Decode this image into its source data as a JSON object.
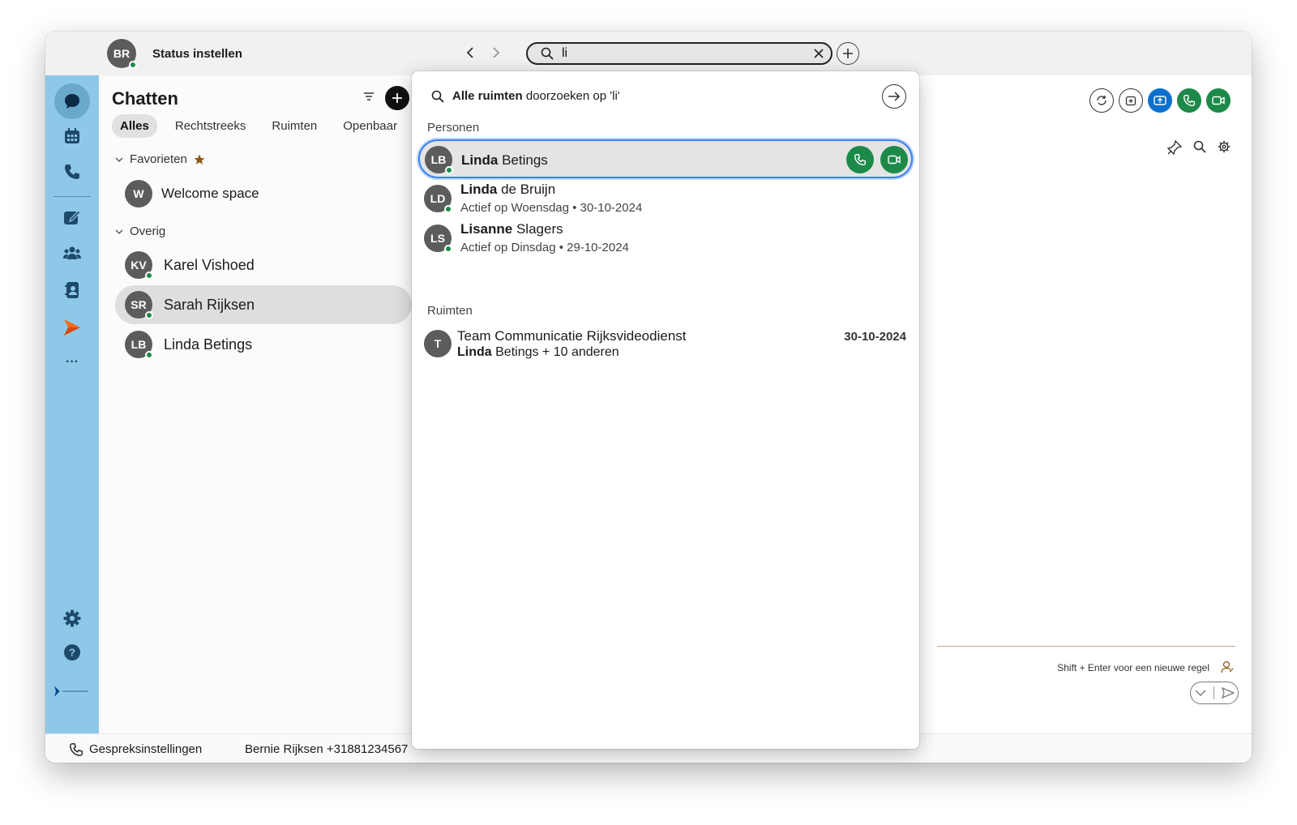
{
  "titlebar": {
    "user_initials": "BR",
    "status_label": "Status instellen",
    "search_value": "li",
    "icons": [
      "back-icon",
      "forward-icon",
      "search-icon",
      "clear-icon",
      "plus-icon"
    ]
  },
  "rail": {
    "items": [
      "chat-icon",
      "calendar-icon",
      "phone-icon",
      "compose-icon",
      "teams-icon",
      "contacts-icon",
      "send-app-icon",
      "more-icon",
      "settings-icon",
      "help-icon",
      "brand-logo"
    ],
    "more_label": "···"
  },
  "chats": {
    "title": "Chatten",
    "tabs": [
      {
        "label": "Alles",
        "active": true
      },
      {
        "label": "Rechtstreeks",
        "active": false
      },
      {
        "label": "Ruimten",
        "active": false
      },
      {
        "label": "Openbaar",
        "active": false
      }
    ],
    "favorites_label": "Favorieten",
    "favorites": [
      {
        "initials": "W",
        "name": "Welcome space"
      }
    ],
    "other_label": "Overig",
    "other": [
      {
        "initials": "KV",
        "name": "Karel Vishoed",
        "selected": false
      },
      {
        "initials": "SR",
        "name": "Sarah Rijksen",
        "selected": true
      },
      {
        "initials": "LB",
        "name": "Linda Betings",
        "selected": false
      }
    ]
  },
  "bottombar": {
    "call_settings": "Gespreksinstellingen",
    "caller": "Bernie Rijksen +31881234567"
  },
  "right_pane": {
    "composer_hint": "Shift + Enter voor een nieuwe regel"
  },
  "dropdown": {
    "search_all_bold": "Alle ruimten",
    "search_all_rest": " doorzoeken op 'li'",
    "people_label": "Personen",
    "people": [
      {
        "initials": "LB",
        "name_bold": "Linda",
        "name_rest": " Betings",
        "sub": "",
        "highlighted": true
      },
      {
        "initials": "LD",
        "name_bold": "Linda",
        "name_rest": " de Bruijn",
        "sub": "Actief op Woensdag • 30-10-2024",
        "highlighted": false
      },
      {
        "initials": "LS",
        "name_bold": "Lisanne",
        "name_rest": " Slagers",
        "sub": "Actief op Dinsdag • 29-10-2024",
        "highlighted": false
      }
    ],
    "rooms_label": "Ruimten",
    "rooms": [
      {
        "initials": "T",
        "name": "Team Communicatie Rijksvideodienst",
        "sub_bold": "Linda",
        "sub_rest": " Betings + 10 anderen",
        "date": "30-10-2024"
      }
    ]
  },
  "colors": {
    "rail": "#8ec8e8",
    "accent_green": "#1d8a4a",
    "accent_blue": "#0a6fce",
    "highlight_border": "#3b82f6",
    "favorite_star": "#8a5a14"
  }
}
